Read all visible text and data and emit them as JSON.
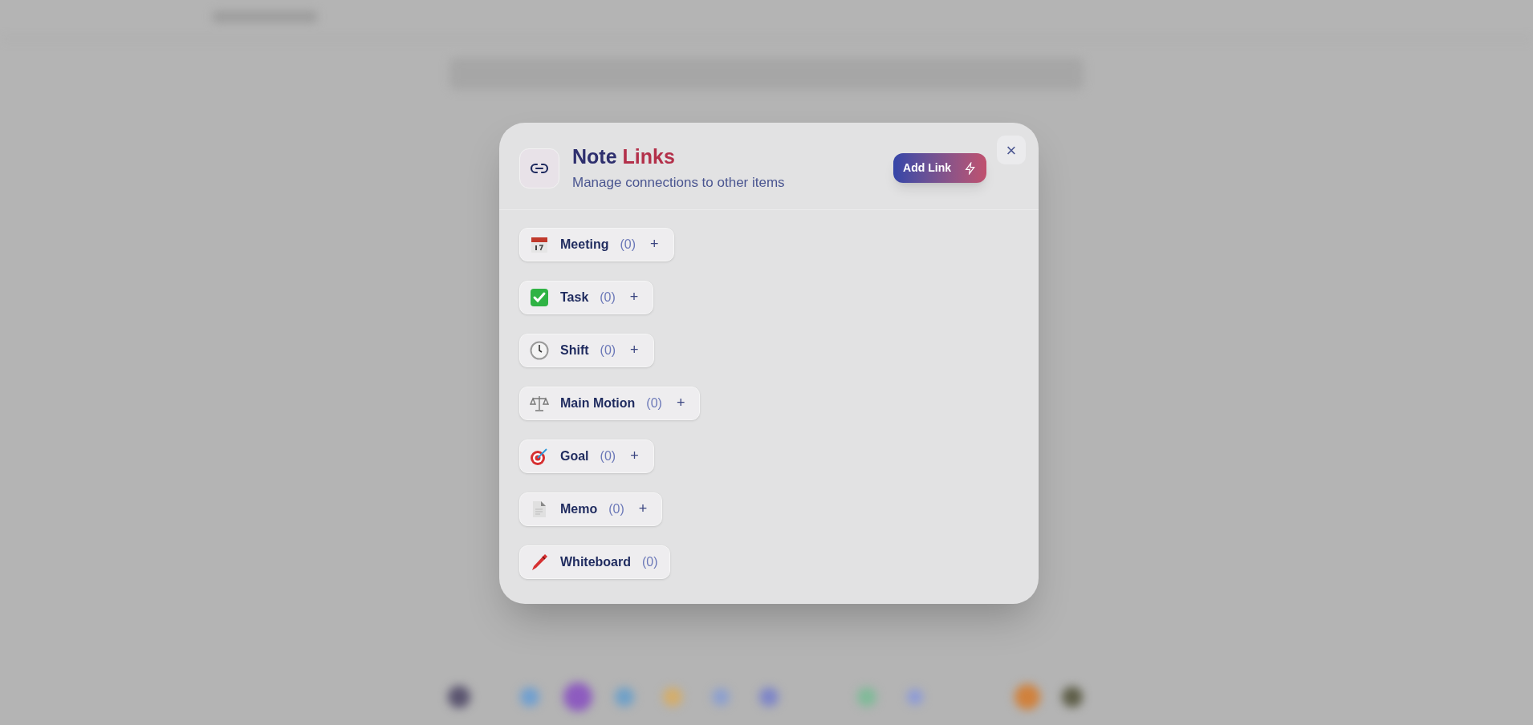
{
  "dialog": {
    "title": {
      "first": "Note",
      "second": "Links"
    },
    "subtitle": "Manage connections to other items",
    "add_button": "Add Link",
    "close": "×"
  },
  "link_types": [
    {
      "label": "Meeting",
      "count": "(0)",
      "add": "+"
    },
    {
      "label": "Task",
      "count": "(0)",
      "add": "+"
    },
    {
      "label": "Shift",
      "count": "(0)",
      "add": "+"
    },
    {
      "label": "Main Motion",
      "count": "(0)",
      "add": "+"
    },
    {
      "label": "Goal",
      "count": "(0)",
      "add": "+"
    },
    {
      "label": "Memo",
      "count": "(0)",
      "add": "+"
    },
    {
      "label": "Whiteboard",
      "count": "(0)"
    }
  ]
}
